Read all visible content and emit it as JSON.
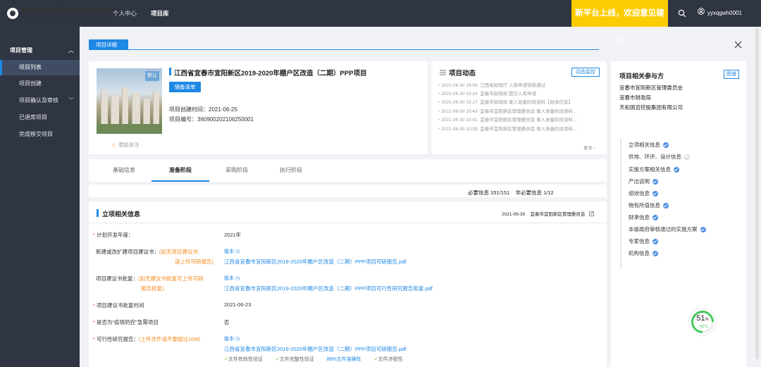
{
  "header": {
    "logo_cn": "财政部政府和社会资本合作中心",
    "logo_en": "CHINA PUBLIC PRIVATE PARTNERSHIPS CENTER",
    "logo_short": "CPPPC",
    "nav": [
      {
        "label": "个人中心"
      },
      {
        "label": "项目库"
      }
    ],
    "banner": "新平台上线，欢迎意见建议",
    "username": "yyxqgwh0001"
  },
  "sidebar": {
    "group": "项目管理",
    "items": [
      {
        "label": "项目列表"
      },
      {
        "label": "项目创建"
      },
      {
        "label": "项目确认及审核"
      },
      {
        "label": "已退库项目"
      },
      {
        "label": "完成移交项目"
      }
    ]
  },
  "tab": {
    "label": "项目详细"
  },
  "project": {
    "title": "江西省宜春市宜阳新区2019-2020年棚户区改造（二期）PPP项目",
    "badge": "储备清单",
    "image_tag": "默认",
    "created": "项目创建时间：2021-06-25",
    "number": "项目编号：36090020210625​0001",
    "follow": "添加关注"
  },
  "dynamics": {
    "title": "项目动态",
    "button": "动态监控",
    "more": "更多",
    "logs": [
      {
        "time": "2021-06-30 16:08",
        "text": "江西省财政厅  入库申请审核通过"
      },
      {
        "time": "2021-06-30 15:24",
        "text": "宜春市财政局  提交入库申请"
      },
      {
        "time": "2021-06-30 15:17",
        "text": "宜春市财政局  录入准备阶段资料【财承信息】"
      },
      {
        "time": "2021-06-30 10:43",
        "text": "宜春市宜阳新区管理委员会  录入准备阶段资料..."
      },
      {
        "time": "2021-06-30 10:41",
        "text": "宜春市宜阳新区管理委员会  录入准备阶段资料..."
      },
      {
        "time": "2021-06-30 10:39",
        "text": "宜春市宜阳新区管理委员会  录入准备阶段资料..."
      }
    ]
  },
  "stage_tabs": [
    {
      "label": "基础信息"
    },
    {
      "label": "准备阶段"
    },
    {
      "label": "采购阶段"
    },
    {
      "label": "执行阶段"
    }
  ],
  "required": {
    "text": "必要信息 151/151",
    "optional": "非必要信息 1/12"
  },
  "section": {
    "title": "立项相关信息",
    "date": "2021-06-30",
    "org": "宜春市宜阳新区管理委员会",
    "fields": {
      "plan_year_label": "计划开发年度：",
      "plan_year": "2021年",
      "proposal_label": "新建或改扩建项目建议书：",
      "proposal_hint1": "(如无项目建议书",
      "proposal_hint2": "请上传可研报告)",
      "version_label": "版本",
      "proposal_file": "江西省宜春市宜阳新区2019-2020年棚户区改造（二期）PPP项目可研报告.pdf",
      "approval_label": "项目建议书批复：",
      "approval_hint1": "(如无建议书批复可上传可研",
      "approval_hint2": "报告批复)",
      "approval_file": "江西省宜春市宜阳新区2019-2020年棚户区改造（二期）PPP项目可行性研究报告批复.pdf",
      "approval_time_label": "项目建议书批复时间",
      "approval_time": "2021-06-23",
      "epidemic_label": "是否为\"疫情防控\"急需项目",
      "epidemic": "否",
      "feasibility_label": "可行性研究报告：",
      "feasibility_hint": "(上传文件请不要超过10M)",
      "feasibility_file": "江西省宜春市宜阳新区2019-2020年棚户区改造（二期）PPP项目可研报告.pdf",
      "checks": [
        "文件有效性验证",
        "文件完整性验证",
        "88%文件准确性",
        "文件涉密性"
      ]
    }
  },
  "participants": {
    "title": "项目相关参与方",
    "button": "图谱",
    "list": [
      "宜春市宜阳新区管理委员会",
      "宜春市财政局",
      "天和国咨控股集团有限公司"
    ]
  },
  "toc": [
    {
      "label": "立项相关信息",
      "done": true
    },
    {
      "label": "供地、环评、设计信息",
      "done": false
    },
    {
      "label": "实施方案相关信息",
      "done": true
    },
    {
      "label": "产出说明",
      "done": true
    },
    {
      "label": "绩效信息",
      "done": true
    },
    {
      "label": "物有所值信息",
      "done": true
    },
    {
      "label": "财承信息",
      "done": true
    },
    {
      "label": "本级政府审核通过的实施方案",
      "done": true
    },
    {
      "label": "专家信息",
      "done": true
    },
    {
      "label": "机构信息",
      "done": true
    }
  ],
  "gauge": {
    "percent": "51",
    "unit": "%",
    "temp": "42°C",
    "value": 0.51
  }
}
